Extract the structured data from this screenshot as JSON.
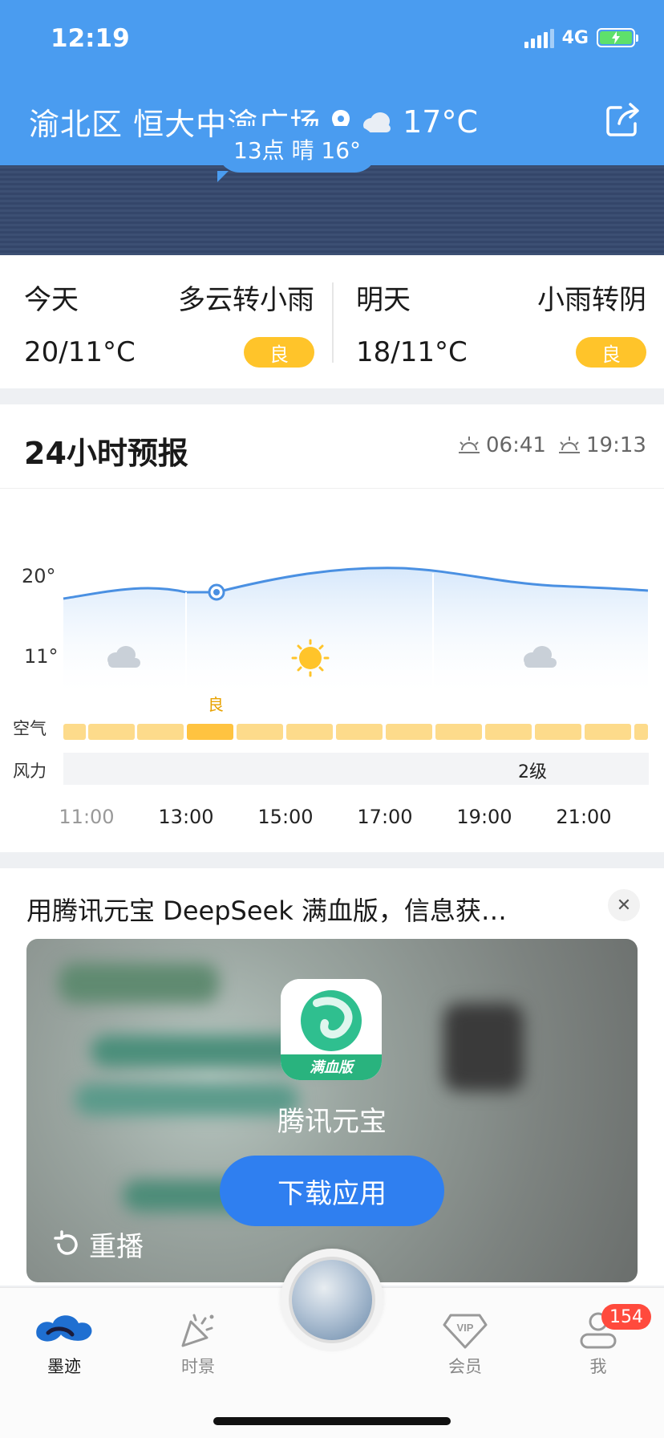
{
  "status_bar": {
    "time": "12:19",
    "network": "4G"
  },
  "header": {
    "location": "渝北区 恒大中渝广场",
    "temperature": "17°C",
    "icons": [
      "location-pin-icon",
      "cloud-icon",
      "share-icon"
    ]
  },
  "daily": {
    "today": {
      "label": "今天",
      "condition": "多云转小雨",
      "temp_range": "20/11°C",
      "aqi": "良"
    },
    "tomorrow": {
      "label": "明天",
      "condition": "小雨转阴",
      "temp_range": "18/11°C",
      "aqi": "良"
    }
  },
  "forecast24h": {
    "title": "24小时预报",
    "sunrise": "06:41",
    "sunset": "19:13",
    "tooltip": "13点 晴 16°",
    "y_max_label": "20°",
    "y_min_label": "11°",
    "air_label": "空气",
    "air_value": "良",
    "wind_label": "风力",
    "wind_value": "2级",
    "time_ticks": [
      "11:00",
      "13:00",
      "15:00",
      "17:00",
      "19:00",
      "21:00"
    ],
    "segment_icons": [
      "cloud-icon",
      "sun-icon",
      "cloud-icon"
    ]
  },
  "ad": {
    "title": "用腾讯元宝 DeepSeek 满血版，信息获…",
    "app_name": "腾讯元宝",
    "app_badge": "满血版",
    "download": "下载应用",
    "replay": "重播"
  },
  "nav": {
    "items": [
      {
        "label": "墨迹",
        "icon": "moji-cloud-icon"
      },
      {
        "label": "时景",
        "icon": "party-popper-icon"
      },
      {
        "label": "会员",
        "icon": "vip-diamond-icon"
      },
      {
        "label": "我",
        "icon": "user-icon"
      }
    ],
    "badge": "154"
  },
  "colors": {
    "header_blue": "#4a9cf0",
    "aqi_yellow": "#ffc42a",
    "button_blue": "#2f7ff0",
    "badge_red": "#ff4a3d"
  }
}
